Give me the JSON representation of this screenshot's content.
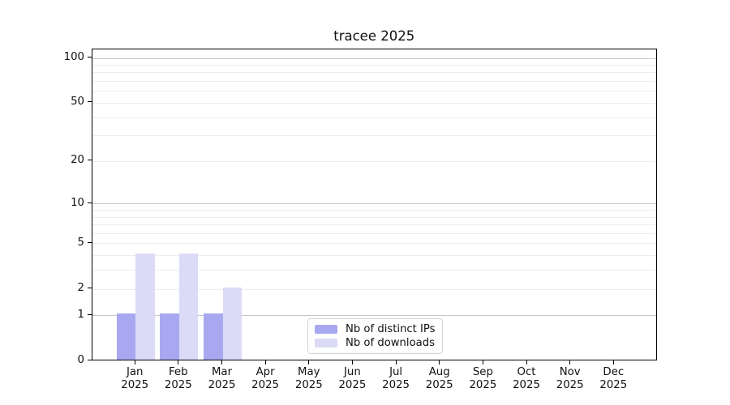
{
  "chart_data": {
    "type": "bar",
    "title": "tracee 2025",
    "categories": [
      "Jan",
      "Feb",
      "Mar",
      "Apr",
      "May",
      "Jun",
      "Jul",
      "Aug",
      "Sep",
      "Oct",
      "Nov",
      "Dec"
    ],
    "x_year_label": "2025",
    "series": [
      {
        "name": "Nb of distinct IPs",
        "color": "#a8a8f0",
        "values": [
          1,
          1,
          1,
          0,
          0,
          0,
          0,
          0,
          0,
          0,
          0,
          0
        ]
      },
      {
        "name": "Nb of downloads",
        "color": "#dbdbf7",
        "values": [
          4,
          4,
          2,
          0,
          0,
          0,
          0,
          0,
          0,
          0,
          0,
          0
        ]
      }
    ],
    "yscale": "log10(value+1)",
    "ylim": [
      0,
      114
    ],
    "yticks": [
      {
        "value": 100,
        "label": "100"
      },
      {
        "value": 50,
        "label": "50"
      },
      {
        "value": 20,
        "label": "20"
      },
      {
        "value": 10,
        "label": "10"
      },
      {
        "value": 5,
        "label": "5"
      },
      {
        "value": 2,
        "label": "2"
      },
      {
        "value": 1,
        "label": "1"
      },
      {
        "value": 0,
        "label": "0"
      }
    ],
    "grid": {
      "on": true,
      "major_values": [
        1,
        10,
        100
      ],
      "minor_values": [
        2,
        3,
        4,
        5,
        6,
        7,
        8,
        9,
        20,
        30,
        40,
        50,
        60,
        70,
        80,
        90
      ],
      "major_color": "#c6c6c6",
      "minor_color": "#ededed"
    },
    "legend": {
      "position": "lower center"
    }
  }
}
